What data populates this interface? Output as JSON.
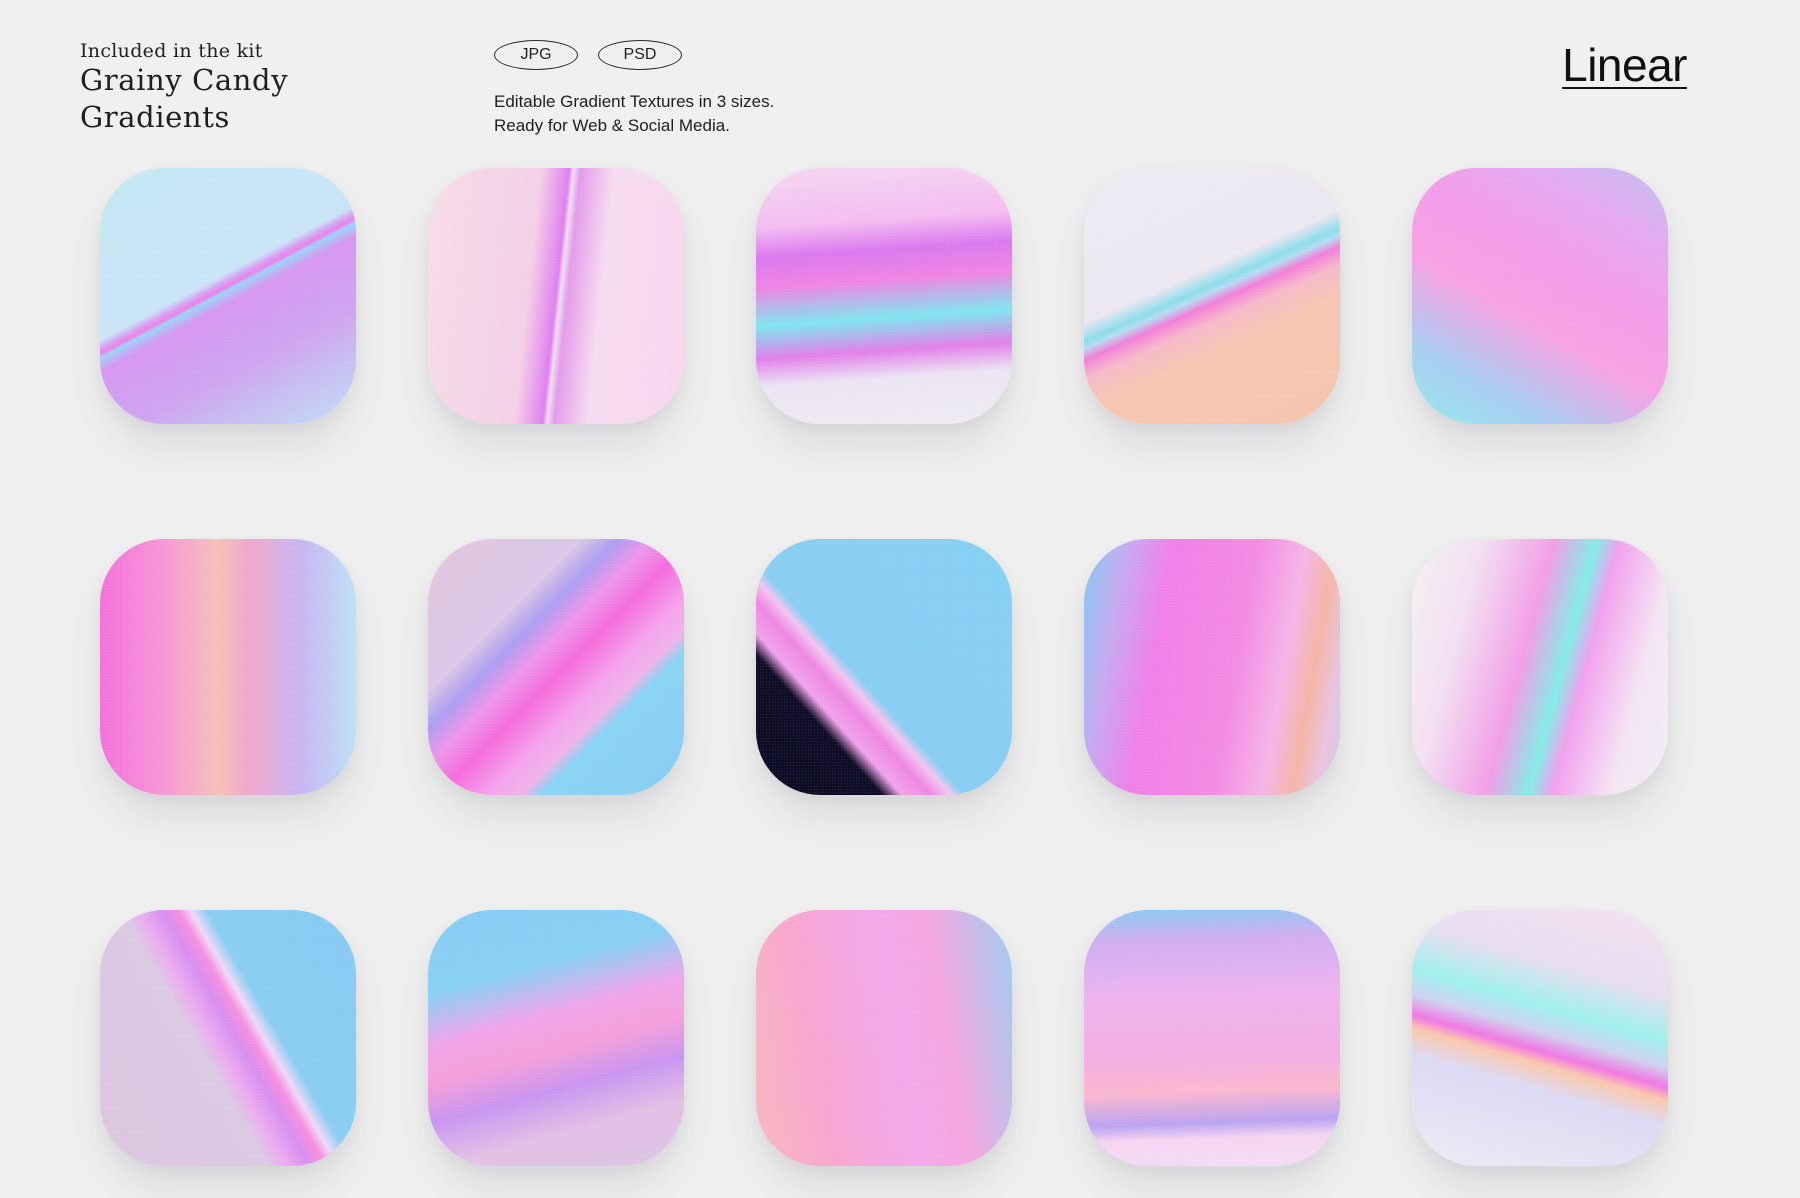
{
  "header": {
    "kit_label": "Included in the kit",
    "kit_title": "Grainy Candy Gradients",
    "formats": [
      "JPG",
      "PSD"
    ],
    "description_lines": [
      "Editable Gradient Textures in 3 sizes.",
      "Ready for Web & Social Media."
    ],
    "style_name": "Linear"
  },
  "tiles": [
    {
      "name": "gradient-tile-1",
      "colors": [
        "#c3e8f4",
        "#d697f2",
        "#ef7de8",
        "#bde1f5"
      ]
    },
    {
      "name": "gradient-tile-2",
      "colors": [
        "#f6dde9",
        "#de7ff0",
        "#f8d5ef"
      ]
    },
    {
      "name": "gradient-tile-3",
      "colors": [
        "#f6d6f1",
        "#da78ef",
        "#7fe5ee",
        "#eeebf2"
      ]
    },
    {
      "name": "gradient-tile-4",
      "colors": [
        "#ecebf2",
        "#8cdceb",
        "#f27ed9",
        "#f6c3ae"
      ]
    },
    {
      "name": "gradient-tile-5",
      "colors": [
        "#c0bef0",
        "#f39be8",
        "#93eaee"
      ]
    },
    {
      "name": "gradient-tile-6",
      "colors": [
        "#f470dc",
        "#f5c1b5",
        "#c9b4f2",
        "#bce0f5"
      ]
    },
    {
      "name": "gradient-tile-7",
      "colors": [
        "#e2c5dd",
        "#ad9cf0",
        "#f56bdc",
        "#86ccf3"
      ]
    },
    {
      "name": "gradient-tile-8",
      "colors": [
        "#86cff4",
        "#ee86e3",
        "#0a0a22"
      ]
    },
    {
      "name": "gradient-tile-9",
      "colors": [
        "#81c9f2",
        "#f07fe8",
        "#f5b4a6",
        "#d8c5e6"
      ]
    },
    {
      "name": "gradient-tile-10",
      "colors": [
        "#f4f1f3",
        "#f29de8",
        "#82ece8",
        "#f1eef4"
      ]
    },
    {
      "name": "gradient-tile-11",
      "colors": [
        "#dcc4df",
        "#d88ef0",
        "#87c9f3"
      ]
    },
    {
      "name": "gradient-tile-12",
      "colors": [
        "#87cbf4",
        "#f49fd9",
        "#c994f1",
        "#dcc4e2"
      ]
    },
    {
      "name": "gradient-tile-13",
      "colors": [
        "#f7b7be",
        "#f1a8eb",
        "#9ccef2"
      ]
    },
    {
      "name": "gradient-tile-14",
      "colors": [
        "#87cbf3",
        "#eeb2ef",
        "#fbb7cf",
        "#b9a3f0"
      ]
    },
    {
      "name": "gradient-tile-15",
      "colors": [
        "#f4e0f0",
        "#9ff1ec",
        "#f177e4",
        "#fac7ad"
      ]
    }
  ]
}
